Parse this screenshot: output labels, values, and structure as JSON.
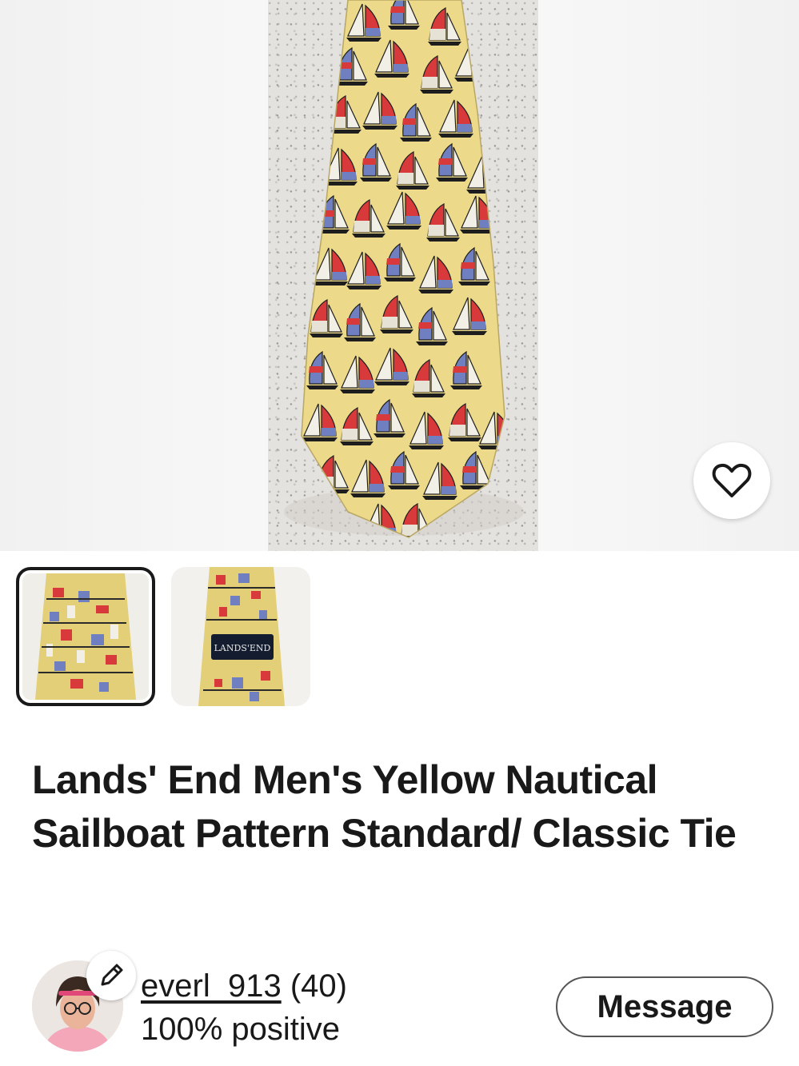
{
  "listing": {
    "title": "Lands' End Men's Yellow Nautical Sailboat Pattern Standard/ Classic Tie"
  },
  "gallery": {
    "thumbnails": [
      {
        "label": "thumbnail-1",
        "selected": true
      },
      {
        "label": "thumbnail-2",
        "selected": false,
        "tag_text": "LANDS'END"
      }
    ]
  },
  "actions": {
    "favorite_icon": "heart-icon"
  },
  "seller": {
    "username": "everl_913",
    "feedback_count": "(40)",
    "positive": "100% positive",
    "edit_icon": "pencil-icon",
    "message_label": "Message"
  },
  "colors": {
    "tie_yellow": "#ecd98a",
    "sail_red": "#d8393a",
    "sail_blue": "#6f7fc0",
    "text": "#191919"
  }
}
